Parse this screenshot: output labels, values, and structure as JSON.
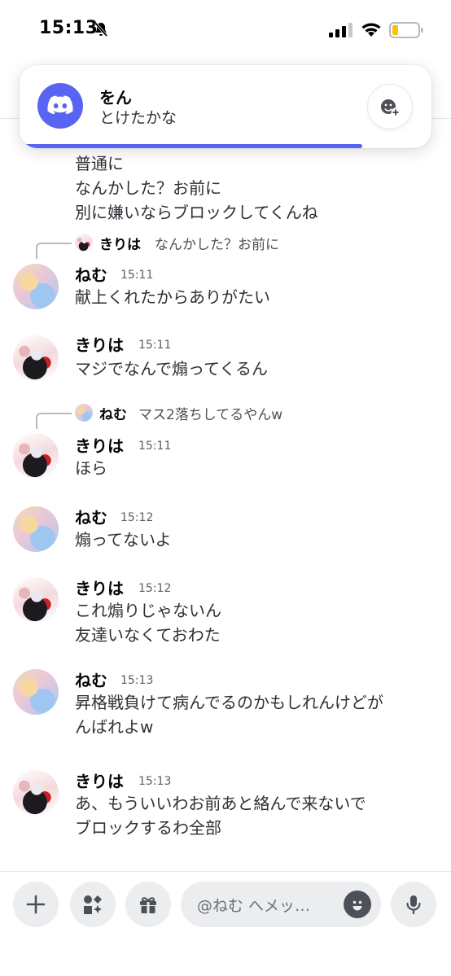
{
  "status_bar": {
    "time": "15:13",
    "icons": [
      "bell-slash-icon",
      "cellular-signal-icon",
      "wifi-icon",
      "battery-low-icon"
    ]
  },
  "notification": {
    "app_icon": "discord-icon",
    "title": "をん",
    "body": "とけたかな",
    "action_icon": "add-reaction-icon",
    "progress": 0.84,
    "accent_color": "#5865f2"
  },
  "continued_message": {
    "lines": [
      "普通に",
      "なんかした？お前に",
      "別に嫌いならブロックしてくんね"
    ]
  },
  "messages": [
    {
      "reply": {
        "name": "きりは",
        "text": "なんかした？お前に"
      },
      "author": "ねむ",
      "time": "15:11",
      "lines": [
        "献上くれたからありがたい"
      ]
    },
    {
      "author": "きりは",
      "time": "15:11",
      "lines": [
        "マジでなんで煽ってくるん"
      ]
    },
    {
      "reply": {
        "name": "ねむ",
        "text": "マス2落ちしてるやんw"
      },
      "author": "きりは",
      "time": "15:11",
      "lines": [
        "ほら"
      ]
    },
    {
      "author": "ねむ",
      "time": "15:12",
      "lines": [
        "煽ってないよ"
      ]
    },
    {
      "author": "きりは",
      "time": "15:12",
      "lines": [
        "これ煽りじゃないん",
        "友達いなくておわた"
      ]
    },
    {
      "author": "ねむ",
      "time": "15:13",
      "lines": [
        "昇格戦負けて病んでるのかもしれんけどが",
        "んばれよw"
      ]
    },
    {
      "author": "きりは",
      "time": "15:13",
      "lines": [
        "あ、もういいわお前あと絡んで来ないで",
        "ブロックするわ全部"
      ]
    }
  ],
  "composer": {
    "buttons": [
      "plus-icon",
      "apps-icon",
      "gift-icon"
    ],
    "placeholder": "@ねむ へメッ…",
    "emoji_icon": "emoji-icon",
    "mic_icon": "microphone-icon"
  }
}
